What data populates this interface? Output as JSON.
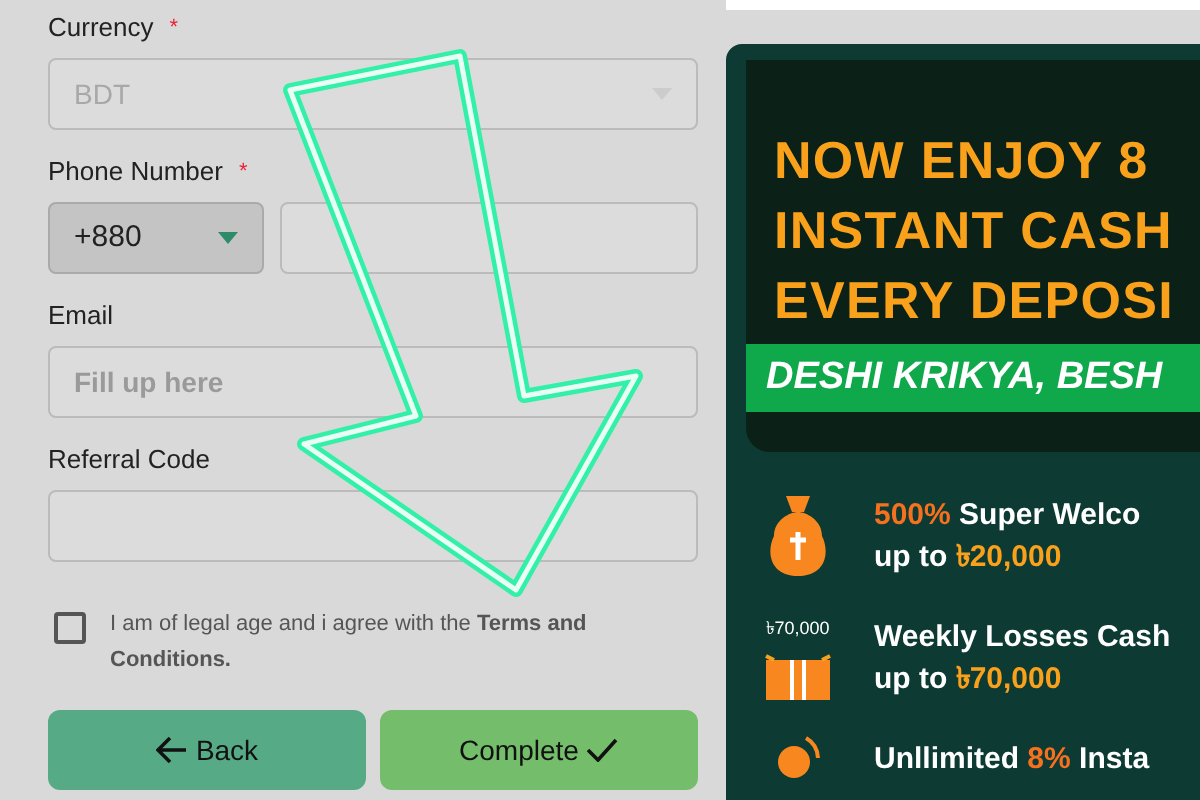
{
  "form": {
    "fields": [
      {
        "kind": "select",
        "label": "Currency",
        "required_mark": "*",
        "value": "BDT",
        "disabled": true
      },
      {
        "kind": "phone",
        "label": "Phone Number",
        "required_mark": "*",
        "code": "+880"
      },
      {
        "kind": "text",
        "label": "Email",
        "placeholder": "Fill up here"
      },
      {
        "kind": "text",
        "label": "Referral Code"
      }
    ],
    "agreement": {
      "checked": false,
      "text": "I am of legal age and i agree with the **Terms and Conditions.**"
    },
    "buttons": [
      {
        "kind": "back",
        "label": "Back"
      },
      {
        "kind": "complete",
        "label": "Complete"
      }
    ]
  },
  "banner": {
    "headline": [
      "NOW ENJOY 8",
      "INSTANT CASH",
      "EVERY DEPOSI"
    ],
    "ribbon": "DESHI KRIKYA, BESH"
  },
  "promos": [
    {
      "kind": "bag",
      "lines": [
        [
          {
            "text": "500%",
            "accent": true
          },
          {
            "text": " Super Welco",
            "accent": false
          }
        ],
        [
          {
            "text": "up to ",
            "accent": false
          },
          {
            "text": "৳20,000",
            "accent": true
          }
        ]
      ]
    },
    {
      "kind": "gift",
      "badge": "৳70,000",
      "lines": [
        [
          {
            "text": "Weekly Losses Cash",
            "accent": false
          }
        ],
        [
          {
            "text": "up to ",
            "accent": false
          },
          {
            "text": "৳70,000",
            "accent": true
          }
        ]
      ]
    },
    {
      "kind": "coin",
      "lines": [
        [
          {
            "text": "Unllimited ",
            "accent": false
          },
          {
            "text": "8%",
            "accent": true
          },
          {
            "text": " Insta",
            "accent": false
          }
        ]
      ]
    }
  ]
}
